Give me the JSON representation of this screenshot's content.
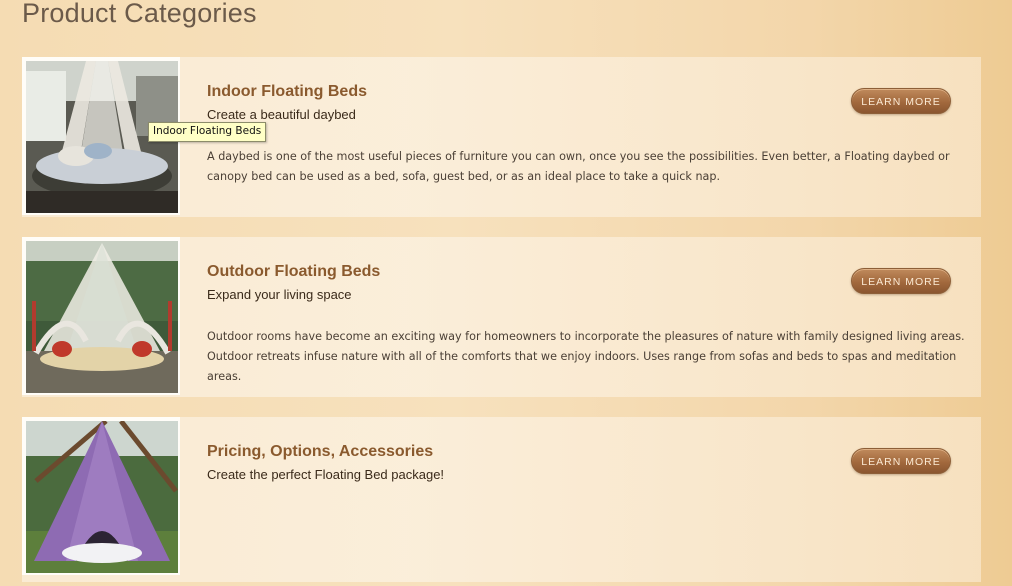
{
  "page": {
    "title": "Product Categories"
  },
  "categories": [
    {
      "title": "Indoor Floating Beds",
      "subtitle": "Create a beautiful daybed",
      "description": "A daybed is one of the most useful pieces of furniture you can own, once you see the possibilities. Even better, a Floating daybed or canopy bed can be used as a bed, sofa, guest bed, or as an ideal place to take a quick nap.",
      "button": "LEARN MORE",
      "image_alt": "Indoor Floating Beds"
    },
    {
      "title": "Outdoor Floating Beds",
      "subtitle": "Expand your living space",
      "description": "Outdoor rooms have become an exciting way for homeowners to incorporate the pleasures of nature with family designed living areas. Outdoor retreats infuse nature with all of the comforts that we enjoy indoors. Uses range from sofas and beds to spas and meditation areas.",
      "button": "LEARN MORE",
      "image_alt": "Outdoor Floating Beds"
    },
    {
      "title": "Pricing, Options, Accessories",
      "subtitle": "Create the perfect Floating Bed package!",
      "description": "",
      "button": "LEARN MORE",
      "image_alt": "Pricing, Options, Accessories"
    }
  ],
  "tooltip": {
    "text": "Indoor Floating Beds"
  },
  "colors": {
    "title": "#8a5a2e",
    "button": "#a2693d",
    "tooltip_bg": "#ffffc6"
  }
}
